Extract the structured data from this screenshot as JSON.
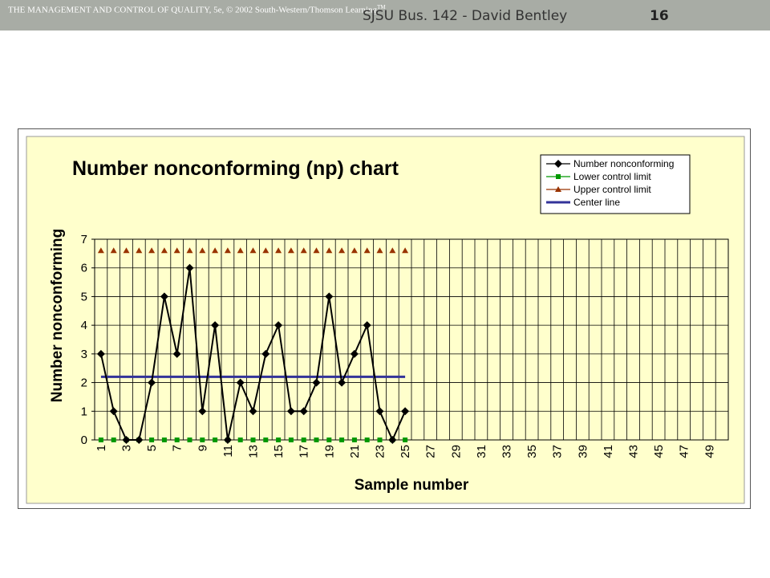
{
  "header": {
    "copyright": "THE MANAGEMENT AND CONTROL OF QUALITY, 5e, © 2002 South-Western/Thomson Learning",
    "copyright_sup": "TM",
    "course": "SJSU Bus. 142 - David Bentley",
    "slide_number": "16"
  },
  "chart_data": {
    "type": "line",
    "title": "Number nonconforming (np) chart",
    "xlabel": "Sample number",
    "ylabel": "Number nonconforming",
    "xlim": [
      1,
      50
    ],
    "ylim": [
      0,
      7
    ],
    "x_ticks": [
      "1",
      "3",
      "5",
      "7",
      "9",
      "11",
      "13",
      "15",
      "17",
      "19",
      "21",
      "23",
      "25",
      "27",
      "29",
      "31",
      "33",
      "35",
      "37",
      "39",
      "41",
      "43",
      "45",
      "47",
      "49"
    ],
    "y_ticks": [
      "0",
      "1",
      "2",
      "3",
      "4",
      "5",
      "6",
      "7"
    ],
    "grid": true,
    "legend_position": "top-right",
    "colors": {
      "plot_background": "#ffffcc",
      "outer_background": "#ffffcc",
      "number_nonconforming": "#000000",
      "lower_control_limit": "#009900",
      "upper_control_limit": "#993300",
      "center_line": "#333399"
    },
    "series": [
      {
        "name": "Number nonconforming",
        "marker": "diamond",
        "x": [
          1,
          2,
          3,
          4,
          5,
          6,
          7,
          8,
          9,
          10,
          11,
          12,
          13,
          14,
          15,
          16,
          17,
          18,
          19,
          20,
          21,
          22,
          23,
          24,
          25
        ],
        "values": [
          3,
          1,
          0,
          0,
          2,
          5,
          3,
          6,
          1,
          4,
          0,
          2,
          1,
          3,
          4,
          1,
          1,
          2,
          5,
          2,
          3,
          4,
          1,
          0,
          1
        ]
      },
      {
        "name": "Lower control limit",
        "marker": "square",
        "x": [
          1,
          2,
          3,
          4,
          5,
          6,
          7,
          8,
          9,
          10,
          11,
          12,
          13,
          14,
          15,
          16,
          17,
          18,
          19,
          20,
          21,
          22,
          23,
          24,
          25
        ],
        "values": [
          0,
          0,
          0,
          0,
          0,
          0,
          0,
          0,
          0,
          0,
          0,
          0,
          0,
          0,
          0,
          0,
          0,
          0,
          0,
          0,
          0,
          0,
          0,
          0,
          0
        ]
      },
      {
        "name": "Upper control limit",
        "marker": "triangle",
        "x": [
          1,
          2,
          3,
          4,
          5,
          6,
          7,
          8,
          9,
          10,
          11,
          12,
          13,
          14,
          15,
          16,
          17,
          18,
          19,
          20,
          21,
          22,
          23,
          24,
          25
        ],
        "values": [
          6.6,
          6.6,
          6.6,
          6.6,
          6.6,
          6.6,
          6.6,
          6.6,
          6.6,
          6.6,
          6.6,
          6.6,
          6.6,
          6.6,
          6.6,
          6.6,
          6.6,
          6.6,
          6.6,
          6.6,
          6.6,
          6.6,
          6.6,
          6.6,
          6.6
        ]
      },
      {
        "name": "Center line",
        "marker": "none",
        "x": [
          1,
          25
        ],
        "values": [
          2.2,
          2.2
        ]
      }
    ]
  }
}
